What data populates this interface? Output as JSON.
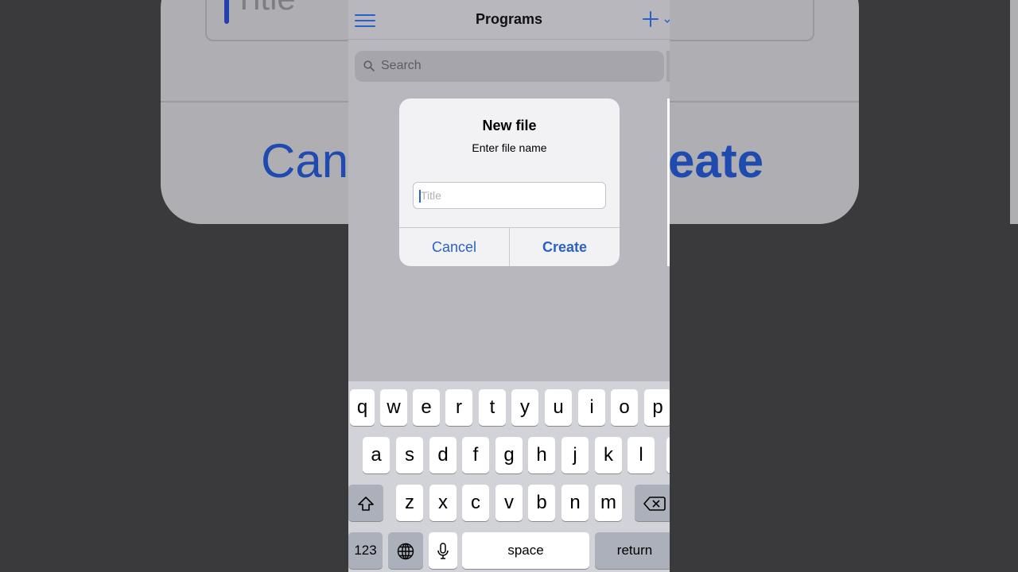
{
  "backdrop": {
    "field_placeholder": "Title",
    "cancel_label": "Canc",
    "create_label": "eate"
  },
  "navbar": {
    "title": "Programs",
    "menu_icon": "hamburger-menu-icon",
    "add_icon": "plus-icon"
  },
  "search": {
    "placeholder": "Search"
  },
  "dialog": {
    "title": "New file",
    "message": "Enter file name",
    "input_value": "",
    "input_placeholder": "Title",
    "cancel_label": "Cancel",
    "create_label": "Create"
  },
  "keyboard": {
    "row1": [
      "q",
      "w",
      "e",
      "r",
      "t",
      "y",
      "u",
      "i",
      "o",
      "p"
    ],
    "row2": [
      "a",
      "s",
      "d",
      "f",
      "g",
      "h",
      "j",
      "k",
      "l"
    ],
    "row3": [
      "z",
      "x",
      "c",
      "v",
      "b",
      "n",
      "m"
    ],
    "numbers_label": "123",
    "space_label": "space",
    "return_label": "return"
  },
  "colors": {
    "accent": "#2a61c9",
    "dim_background": "#b7b7bd",
    "dialog_background": "#f2f2f4"
  }
}
